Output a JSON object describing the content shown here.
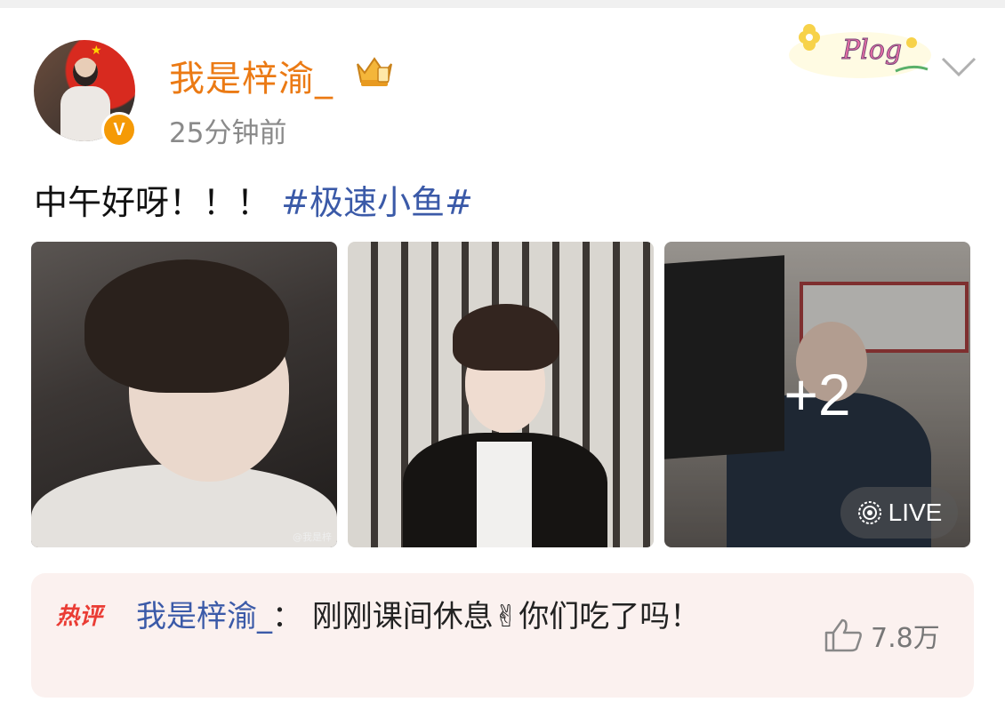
{
  "post": {
    "username": "我是梓渝_",
    "time": "25分钟前",
    "text": "中午好呀！！！",
    "topic": "#极速小鱼#",
    "decoration_label": "Plog",
    "verified_badge": "V"
  },
  "images": {
    "more_count": "+2",
    "live_label": "LIVE",
    "watermark": "@我是梓"
  },
  "hot_comment": {
    "badge": "热评",
    "user": "我是梓渝_",
    "separator": "：",
    "text": "刚刚课间休息",
    "emoji": "✌",
    "text_after": "你们吃了吗！",
    "likes": "7.8万"
  },
  "colors": {
    "username": "#eb7a14",
    "topic": "#3b5aa8",
    "hot_badge": "#ea3c34",
    "comment_bg": "#fbf1ef"
  }
}
